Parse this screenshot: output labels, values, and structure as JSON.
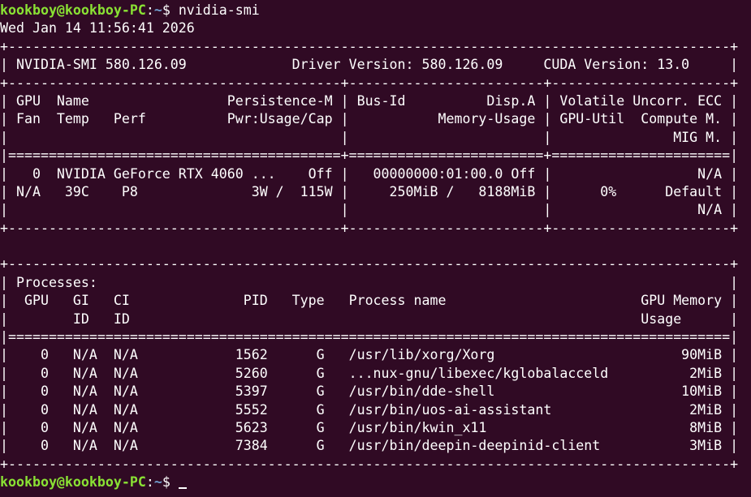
{
  "terminal": {
    "prompt": {
      "user_host": "kookboy@kookboy-PC",
      "sep": ":",
      "path": "~",
      "symbol": "$ "
    },
    "command": "nvidia-smi",
    "lines": [
      "Wed Jan 14 11:56:41 2026",
      "+-----------------------------------------------------------------------------------------+",
      "| NVIDIA-SMI 580.126.09             Driver Version: 580.126.09     CUDA Version: 13.0     |",
      "+-----------------------------------------+------------------------+----------------------+",
      "| GPU  Name                 Persistence-M | Bus-Id          Disp.A | Volatile Uncorr. ECC |",
      "| Fan  Temp   Perf          Pwr:Usage/Cap |           Memory-Usage | GPU-Util  Compute M. |",
      "|                                         |                        |               MIG M. |",
      "|=========================================+========================+======================|",
      "|   0  NVIDIA GeForce RTX 4060 ...    Off |   00000000:01:00.0 Off |                  N/A |",
      "| N/A   39C    P8              3W /  115W |     250MiB /   8188MiB |      0%      Default |",
      "|                                         |                        |                  N/A |",
      "+-----------------------------------------+------------------------+----------------------+",
      "",
      "+-----------------------------------------------------------------------------------------+",
      "| Processes:                                                                              |",
      "|  GPU   GI   CI              PID   Type   Process name                        GPU Memory |",
      "|        ID   ID                                                               Usage      |",
      "|=========================================================================================|",
      "|    0   N/A  N/A            1562      G   /usr/lib/xorg/Xorg                       90MiB |",
      "|    0   N/A  N/A            5260      G   ...nux-gnu/libexec/kglobalacceld          2MiB |",
      "|    0   N/A  N/A            5397      G   /usr/bin/dde-shell                       10MiB |",
      "|    0   N/A  N/A            5552      G   /usr/bin/uos-ai-assistant                 2MiB |",
      "|    0   N/A  N/A            5623      G   /usr/bin/kwin_x11                         8MiB |",
      "|    0   N/A  N/A            7384      G   /usr/bin/deepin-deepinid-client           3MiB |",
      "+-----------------------------------------------------------------------------------------+"
    ]
  },
  "colors": {
    "background": "#300a24",
    "prompt_user": "#8ae234",
    "prompt_path": "#729fcf",
    "text": "#ffffff"
  }
}
